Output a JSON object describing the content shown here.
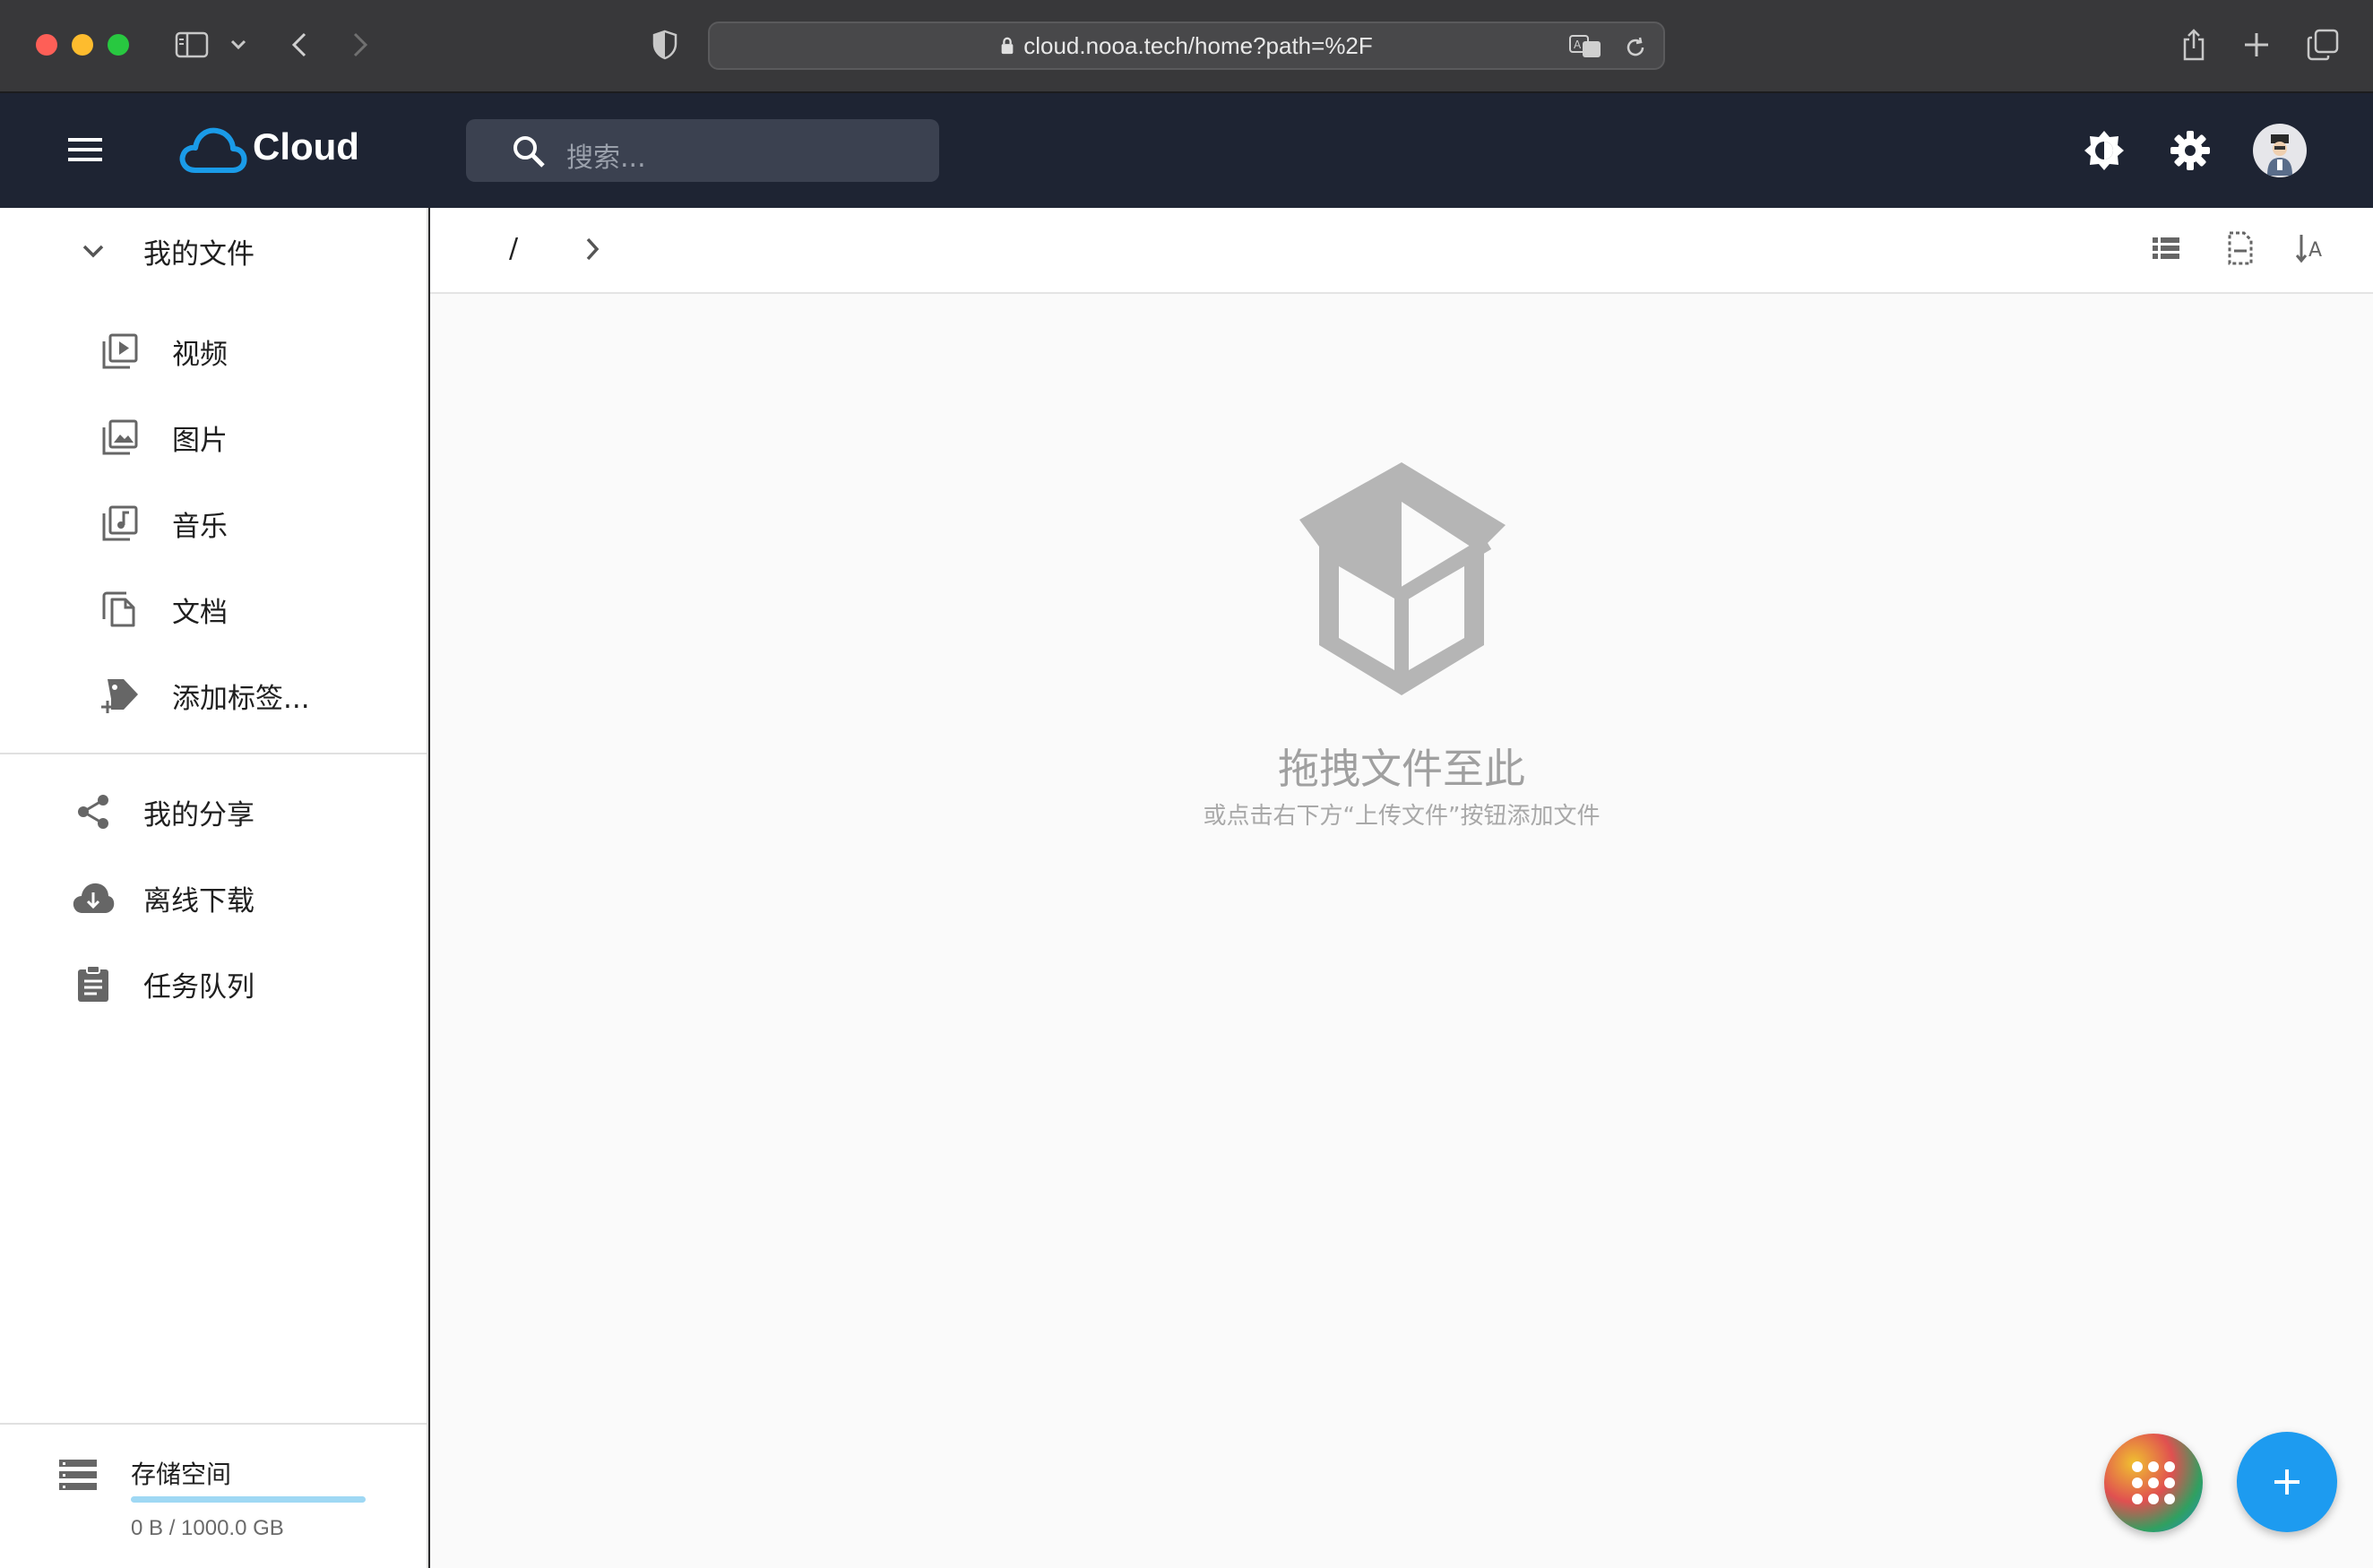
{
  "browser": {
    "url": "cloud.nooa.tech/home?path=%2F"
  },
  "header": {
    "brand": "Cloud",
    "search_placeholder": "搜索..."
  },
  "sidebar": {
    "my_files": "我的文件",
    "categories": [
      {
        "label": "视频",
        "icon": "video-library-icon"
      },
      {
        "label": "图片",
        "icon": "photo-library-icon"
      },
      {
        "label": "音乐",
        "icon": "music-library-icon"
      },
      {
        "label": "文档",
        "icon": "file-copy-icon"
      },
      {
        "label": "添加标签...",
        "icon": "add-tag-icon"
      }
    ],
    "nav": [
      {
        "label": "我的分享",
        "icon": "share-icon"
      },
      {
        "label": "离线下载",
        "icon": "cloud-download-icon"
      },
      {
        "label": "任务队列",
        "icon": "clipboard-icon"
      }
    ],
    "storage": {
      "title": "存储空间",
      "usage": "0 B / 1000.0 GB",
      "used_fraction": 0
    }
  },
  "main": {
    "breadcrumb": "/",
    "empty_title": "拖拽文件至此",
    "empty_subtitle": "或点击右下方“上传文件”按钮添加文件"
  },
  "colors": {
    "appbar": "#1e2433",
    "accent": "#1a9be8",
    "fab_add": "#1d9bf0"
  }
}
